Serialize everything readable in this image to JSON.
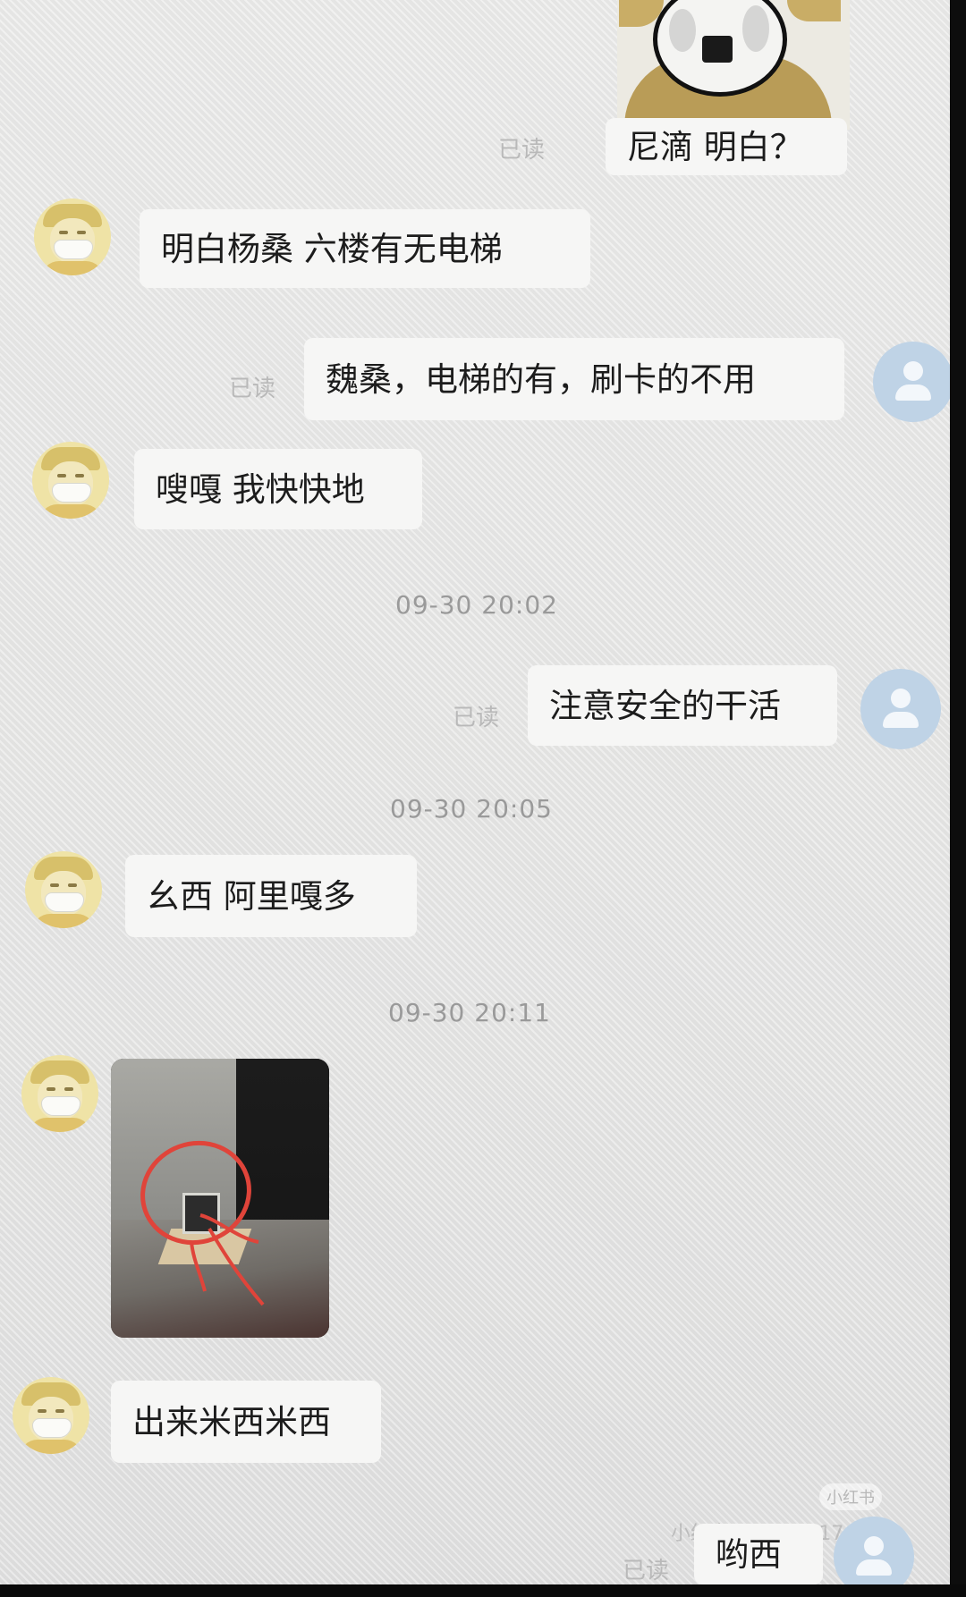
{
  "messages": {
    "m1": {
      "text": "尼滴  明白？",
      "status": "已读"
    },
    "m2": {
      "text": "明白杨桑  六楼有无电梯"
    },
    "m3": {
      "text": "魏桑，电梯的有，刷卡的不用",
      "status": "已读"
    },
    "m4": {
      "text": "嗖嘎  我快快地"
    },
    "t1": "09-30 20:02",
    "m5": {
      "text": "注意安全的干活",
      "status": "已读"
    },
    "t2": "09-30 20:05",
    "m6": {
      "text": "幺西  阿里嘎多"
    },
    "t3": "09-30 20:11",
    "m8": {
      "text": "出来米西米西"
    },
    "m9": {
      "text": "哟西",
      "status": "已读"
    }
  },
  "watermark": {
    "pill": "小红书",
    "id": "小红书号:4212417"
  },
  "colors": {
    "bubble": "#f6f6f5",
    "background": "#e7e7e6",
    "read_status": "#b9b9b9",
    "timestamp": "#9a9a9a",
    "avatar_right": "#bfd3e6",
    "avatar_left": "#efe3a6",
    "annotation": "#e0443a"
  }
}
